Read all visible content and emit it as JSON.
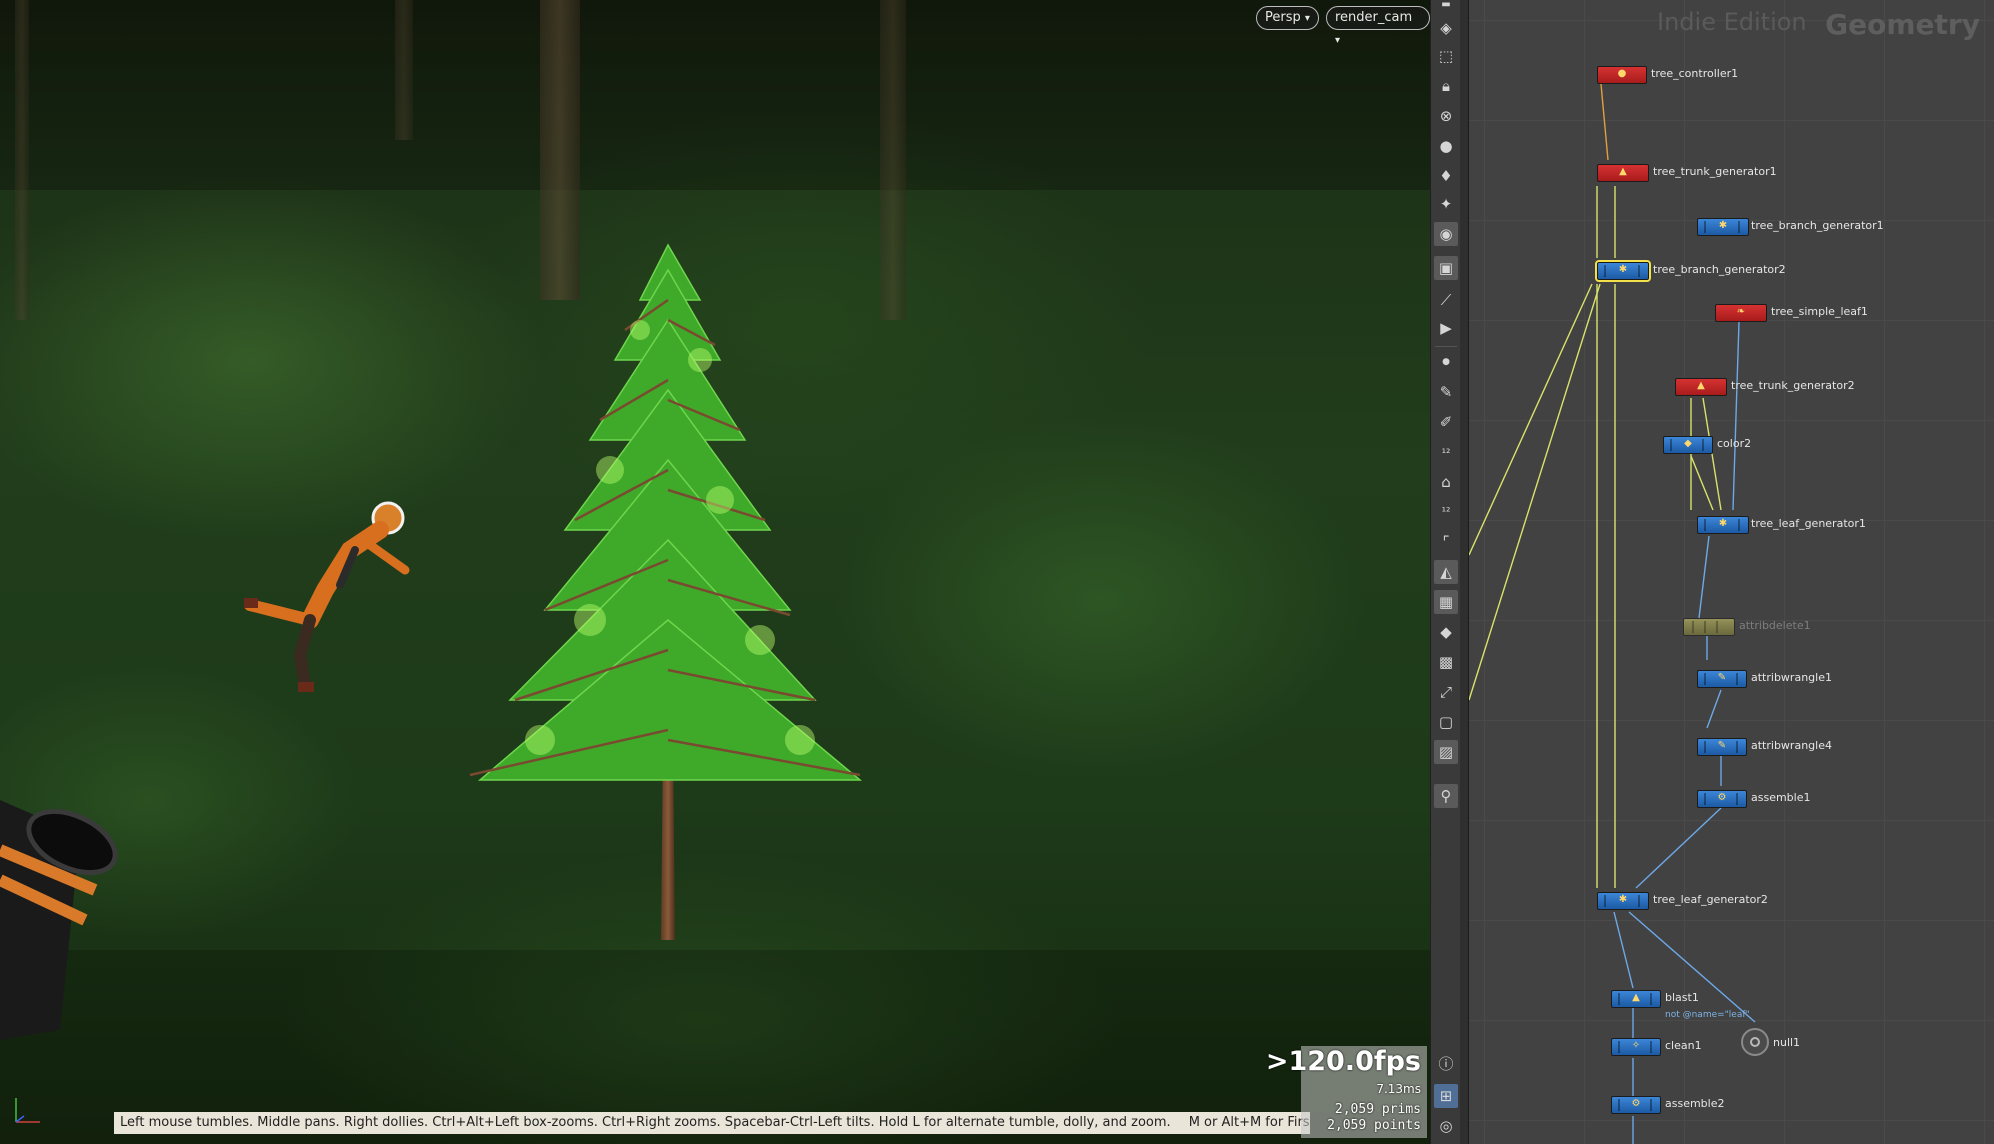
{
  "viewport": {
    "persp_label": "Persp",
    "camera_label": "render_cam",
    "status_hint": "Left mouse tumbles. Middle pans. Right dollies. Ctrl+Alt+Left box-zooms. Ctrl+Right zooms. Spacebar-Ctrl-Left tilts. Hold L for alternate tumble, dolly, and zoom.",
    "status_hint_nav": "M or Alt+M for First Person Navigation.",
    "fps": ">120.0fps",
    "frame_time": "7.13ms",
    "prims": "2,059  prims",
    "points": "2,059 points",
    "dropdown_glyph": "▾"
  },
  "network": {
    "edition": "Indie Edition",
    "context": "Geometry",
    "nodes": {
      "tree_controller1": "tree_controller1",
      "tree_trunk_generator1": "tree_trunk_generator1",
      "tree_branch_generator1": "tree_branch_generator1",
      "tree_branch_generator2": "tree_branch_generator2",
      "tree_simple_leaf1": "tree_simple_leaf1",
      "tree_trunk_generator2": "tree_trunk_generator2",
      "color2": "color2",
      "tree_leaf_generator1": "tree_leaf_generator1",
      "attribdelete1": "attribdelete1",
      "attribwrangle1": "attribwrangle1",
      "attribwrangle4": "attribwrangle4",
      "assemble1": "assemble1",
      "tree_leaf_generator2": "tree_leaf_generator2",
      "blast1": "blast1",
      "blast1_group": "not @name=\"leaf\"",
      "null1": "null1",
      "clean1": "clean1",
      "assemble2": "assemble2"
    }
  },
  "toolbar": {
    "icons": [
      "display-options-icon",
      "ghost-icon",
      "lock-icon",
      "xray-icon",
      "shading-icon",
      "light-icon",
      "headlight-icon",
      "camera-look-icon",
      "camera-icon",
      "wire-icon",
      "render-icon",
      "point-icon",
      "brush-icon",
      "pen-icon",
      "number-icon",
      "stamp-icon",
      "number2-icon",
      "corner-icon",
      "shape-icon",
      "checker-icon",
      "diamond-icon",
      "snap-icon",
      "pointer-icon",
      "square-icon",
      "image-icon",
      "pin-icon",
      "info-icon",
      "grid-icon",
      "eye-icon"
    ]
  },
  "colors": {
    "node_red": "#d63232",
    "node_blue": "#2a70c2",
    "wire_yellow": "#d9e36a",
    "wire_blue": "#6ea8e6",
    "selection": "#f2e14a"
  }
}
